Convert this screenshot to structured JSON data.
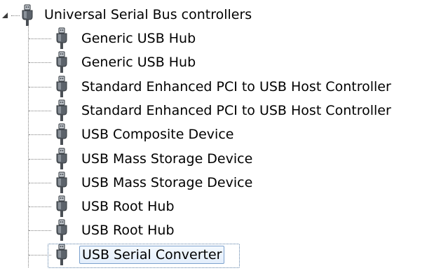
{
  "tree": {
    "root": {
      "label": "Universal Serial Bus controllers",
      "icon": "usb-connector-icon",
      "expanded": true
    },
    "children": [
      {
        "label": "Generic USB Hub",
        "icon": "usb-connector-icon"
      },
      {
        "label": "Generic USB Hub",
        "icon": "usb-connector-icon"
      },
      {
        "label": "Standard Enhanced PCI to USB Host Controller",
        "icon": "usb-connector-icon"
      },
      {
        "label": "Standard Enhanced PCI to USB Host Controller",
        "icon": "usb-connector-icon"
      },
      {
        "label": "USB Composite Device",
        "icon": "usb-connector-icon"
      },
      {
        "label": "USB Mass Storage Device",
        "icon": "usb-connector-icon"
      },
      {
        "label": "USB Mass Storage Device",
        "icon": "usb-connector-icon"
      },
      {
        "label": "USB Root Hub",
        "icon": "usb-connector-icon"
      },
      {
        "label": "USB Root Hub",
        "icon": "usb-connector-icon"
      },
      {
        "label": "USB Serial Converter",
        "icon": "usb-connector-icon",
        "selected": true
      }
    ]
  },
  "colors": {
    "selection_border": "#7da2ce",
    "icon_dark": "#4a4f55",
    "icon_light": "#c9ced4"
  }
}
